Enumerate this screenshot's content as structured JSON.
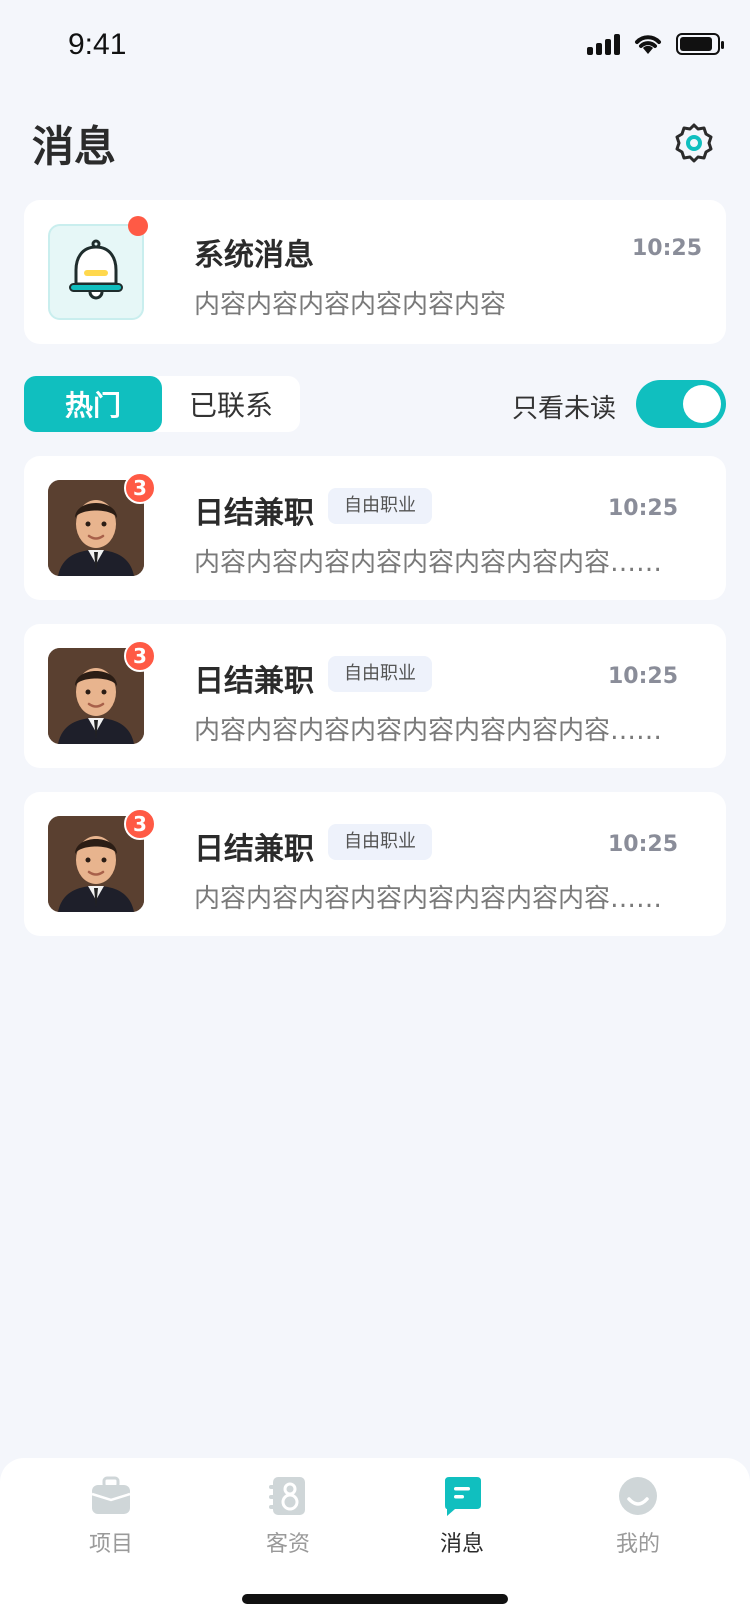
{
  "status_bar": {
    "time": "9:41",
    "battery_level": 0.9
  },
  "header": {
    "title": "消息"
  },
  "system_message": {
    "title": "系统消息",
    "time": "10:25",
    "content": "内容内容内容内容内容内容"
  },
  "tabs": [
    {
      "label": "热门",
      "active": true
    },
    {
      "label": "已联系",
      "active": false
    }
  ],
  "filter": {
    "label": "只看未读",
    "enabled": true
  },
  "messages": [
    {
      "name": "日结兼职",
      "tag": "自由职业",
      "time": "10:25",
      "content": "内容内容内容内容内容内容内容内容……",
      "badge": "3"
    },
    {
      "name": "日结兼职",
      "tag": "自由职业",
      "time": "10:25",
      "content": "内容内容内容内容内容内容内容内容……",
      "badge": "3"
    },
    {
      "name": "日结兼职",
      "tag": "自由职业",
      "time": "10:25",
      "content": "内容内容内容内容内容内容内容内容……",
      "badge": "3"
    }
  ],
  "bottom_nav": [
    {
      "label": "项目",
      "icon": "briefcase-icon",
      "active": false
    },
    {
      "label": "客资",
      "icon": "contacts-icon",
      "active": false
    },
    {
      "label": "消息",
      "icon": "chat-icon",
      "active": true
    },
    {
      "label": "我的",
      "icon": "profile-icon",
      "active": false
    }
  ],
  "colors": {
    "accent": "#10bfbf",
    "badge": "#ff5a45",
    "inactive_icon": "#cfd6d8"
  }
}
